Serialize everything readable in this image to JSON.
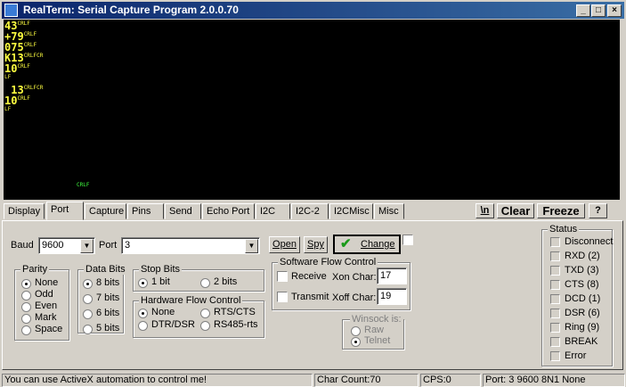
{
  "window": {
    "title": "RealTerm: Serial Capture Program 2.0.0.70"
  },
  "terminal": {
    "lines": [
      {
        "text": "43",
        "ctl": "CRLF"
      },
      {
        "text": "+79",
        "ctl": "CRLF"
      },
      {
        "text": "075",
        "ctl": "CRLF"
      },
      {
        "text": "K13",
        "ctl": "CRLFCR"
      },
      {
        "text": "10",
        "ctl": "CRLF"
      },
      {
        "text": "",
        "ctl": "LF"
      },
      {
        "text": " 13",
        "ctl": "CRLFCR"
      },
      {
        "text": "10",
        "ctl": "CRLF"
      },
      {
        "text": "",
        "ctl": "LF"
      }
    ],
    "cursor_ctl": "CRLF"
  },
  "tabs": [
    "Display",
    "Port",
    "Capture",
    "Pins",
    "Send",
    "Echo Port",
    "I2C",
    "I2C-2",
    "I2CMisc",
    "Misc"
  ],
  "toolbar": {
    "newline": "\\n",
    "clear": "Clear",
    "freeze": "Freeze",
    "help": "?"
  },
  "port": {
    "baud_label": "Baud",
    "baud_value": "9600",
    "port_label": "Port",
    "port_value": "3",
    "open": "Open",
    "spy": "Spy",
    "change": "Change"
  },
  "parity": {
    "title": "Parity",
    "options": [
      "None",
      "Odd",
      "Even",
      "Mark",
      "Space"
    ],
    "selected": "None"
  },
  "databits": {
    "title": "Data Bits",
    "options": [
      "8 bits",
      "7 bits",
      "6 bits",
      "5 bits"
    ],
    "selected": "8 bits"
  },
  "stopbits": {
    "title": "Stop Bits",
    "options": [
      "1 bit",
      "2 bits"
    ],
    "selected": "1 bit"
  },
  "hwflow": {
    "title": "Hardware Flow Control",
    "options": [
      "None",
      "RTS/CTS",
      "DTR/DSR",
      "RS485-rts"
    ],
    "selected": "None"
  },
  "swflow": {
    "title": "Software Flow Control",
    "receive": "Receive",
    "transmit": "Transmit",
    "xon_label": "Xon Char:",
    "xon_value": "17",
    "xoff_label": "Xoff Char:",
    "xoff_value": "19"
  },
  "winsock": {
    "title": "Winsock is:",
    "options": [
      "Raw",
      "Telnet"
    ],
    "selected": "Telnet"
  },
  "status": {
    "title": "Status",
    "items": [
      "Disconnect",
      "RXD (2)",
      "TXD (3)",
      "CTS (8)",
      "DCD (1)",
      "DSR (6)",
      "Ring (9)",
      "BREAK",
      "Error"
    ]
  },
  "statusbar": {
    "message": "You can use ActiveX automation to control me!",
    "char_count": "Char Count:70",
    "cps": "CPS:0",
    "port_status": "Port: 3 9600 8N1 None"
  }
}
